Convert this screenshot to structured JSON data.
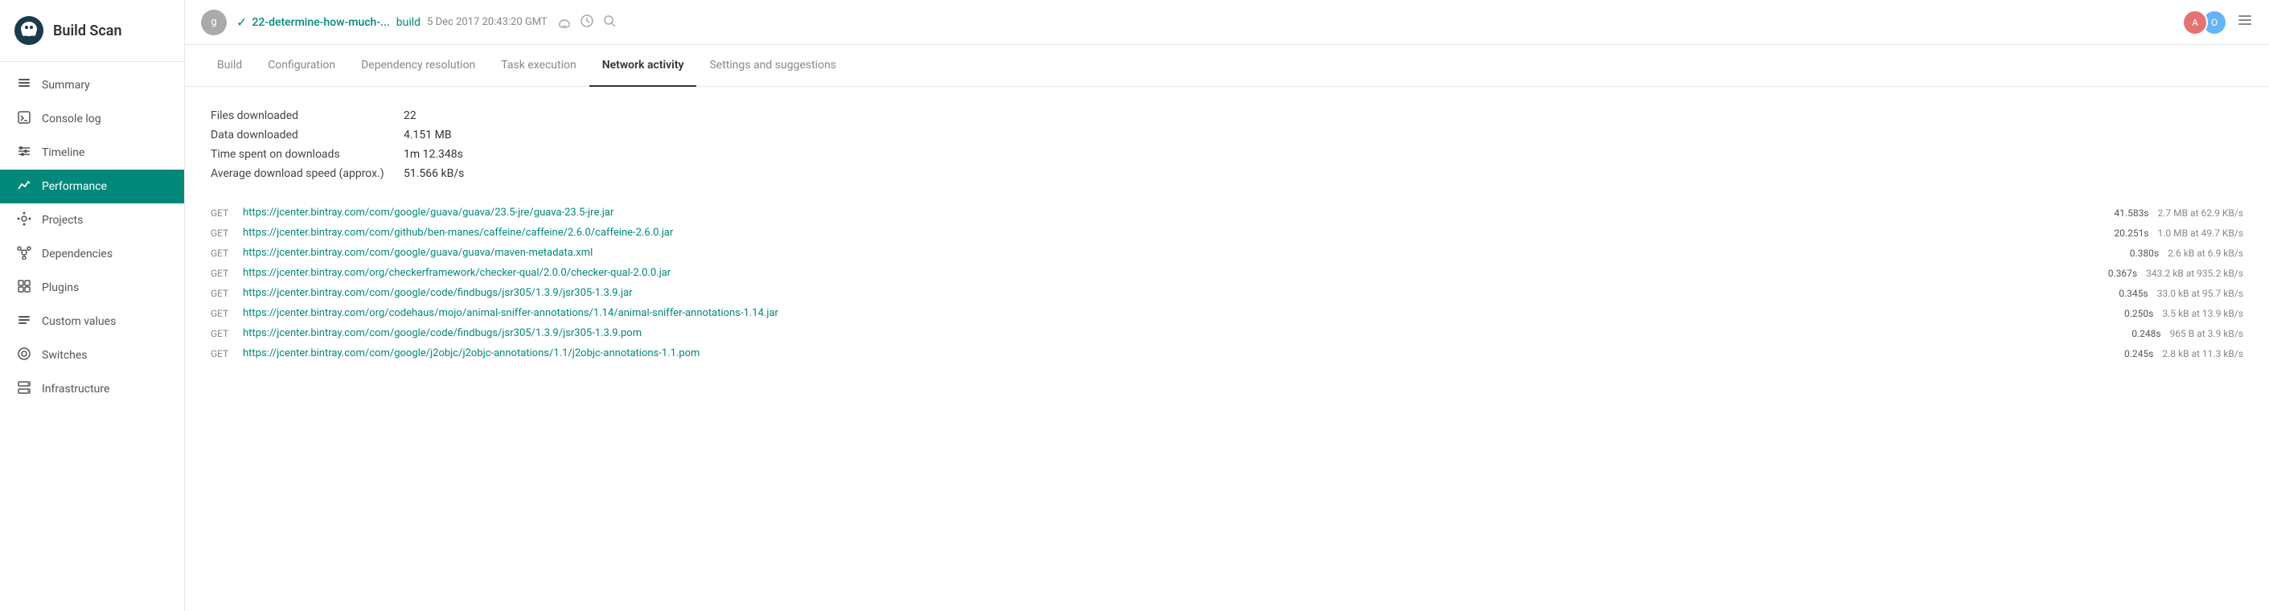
{
  "sidebar": {
    "logo_alt": "Gradle Elephant",
    "title": "Build Scan",
    "items": [
      {
        "id": "summary",
        "label": "Summary",
        "icon": "≡"
      },
      {
        "id": "console-log",
        "label": "Console log",
        "icon": ">"
      },
      {
        "id": "timeline",
        "label": "Timeline",
        "icon": "⊞"
      },
      {
        "id": "performance",
        "label": "Performance",
        "icon": "∿",
        "active": true
      },
      {
        "id": "projects",
        "label": "Projects",
        "icon": "⊙"
      },
      {
        "id": "dependencies",
        "label": "Dependencies",
        "icon": "⊗"
      },
      {
        "id": "plugins",
        "label": "Plugins",
        "icon": "⊡"
      },
      {
        "id": "custom-values",
        "label": "Custom values",
        "icon": "☰"
      },
      {
        "id": "switches",
        "label": "Switches",
        "icon": "⊚"
      },
      {
        "id": "infrastructure",
        "label": "Infrastructure",
        "icon": "⊞"
      }
    ]
  },
  "topbar": {
    "avatar_letter": "g",
    "build_name": "22-determine-how-much-...",
    "build_label": "build",
    "date": "5 Dec 2017 20:43:20 GMT",
    "check_icon": "✓"
  },
  "subnav": {
    "tabs": [
      {
        "id": "build",
        "label": "Build"
      },
      {
        "id": "configuration",
        "label": "Configuration"
      },
      {
        "id": "dependency-resolution",
        "label": "Dependency resolution"
      },
      {
        "id": "task-execution",
        "label": "Task execution"
      },
      {
        "id": "network-activity",
        "label": "Network activity",
        "active": true
      },
      {
        "id": "settings-suggestions",
        "label": "Settings and suggestions"
      }
    ]
  },
  "network": {
    "stats": [
      {
        "label": "Files downloaded",
        "value": "22"
      },
      {
        "label": "Data downloaded",
        "value": "4.151 MB"
      },
      {
        "label": "Time spent on downloads",
        "value": "1m 12.348s"
      },
      {
        "label": "Average download speed (approx.)",
        "value": "51.566 kB/s"
      }
    ],
    "downloads": [
      {
        "method": "GET",
        "url": "https://jcenter.bintray.com/com/google/guava/guava/23.5-jre/guava-23.5-jre.jar",
        "time": "41.583s",
        "size": "2.7 MB at 62.9 KB/s"
      },
      {
        "method": "GET",
        "url": "https://jcenter.bintray.com/com/github/ben-manes/caffeine/caffeine/2.6.0/caffeine-2.6.0.jar",
        "time": "20.251s",
        "size": "1.0 MB at 49.7 KB/s"
      },
      {
        "method": "GET",
        "url": "https://jcenter.bintray.com/com/google/guava/guava/maven-metadata.xml",
        "time": "0.380s",
        "size": "2.6 kB at 6.9 kB/s"
      },
      {
        "method": "GET",
        "url": "https://jcenter.bintray.com/org/checkerframework/checker-qual/2.0.0/checker-qual-2.0.0.jar",
        "time": "0.367s",
        "size": "343.2 kB at 935.2 kB/s"
      },
      {
        "method": "GET",
        "url": "https://jcenter.bintray.com/com/google/code/findbugs/jsr305/1.3.9/jsr305-1.3.9.jar",
        "time": "0.345s",
        "size": "33.0 kB at 95.7 kB/s"
      },
      {
        "method": "GET",
        "url": "https://jcenter.bintray.com/org/codehaus/mojo/animal-sniffer-annotations/1.14/animal-sniffer-annotations-1.14.jar",
        "time": "0.250s",
        "size": "3.5 kB at 13.9 kB/s"
      },
      {
        "method": "GET",
        "url": "https://jcenter.bintray.com/com/google/code/findbugs/jsr305/1.3.9/jsr305-1.3.9.pom",
        "time": "0.248s",
        "size": "965 B at 3.9 kB/s"
      },
      {
        "method": "GET",
        "url": "https://jcenter.bintray.com/com/google/j2objc/j2objc-annotations/1.1/j2objc-annotations-1.1.pom",
        "time": "0.245s",
        "size": "2.8 kB at 11.3 kB/s"
      }
    ]
  }
}
